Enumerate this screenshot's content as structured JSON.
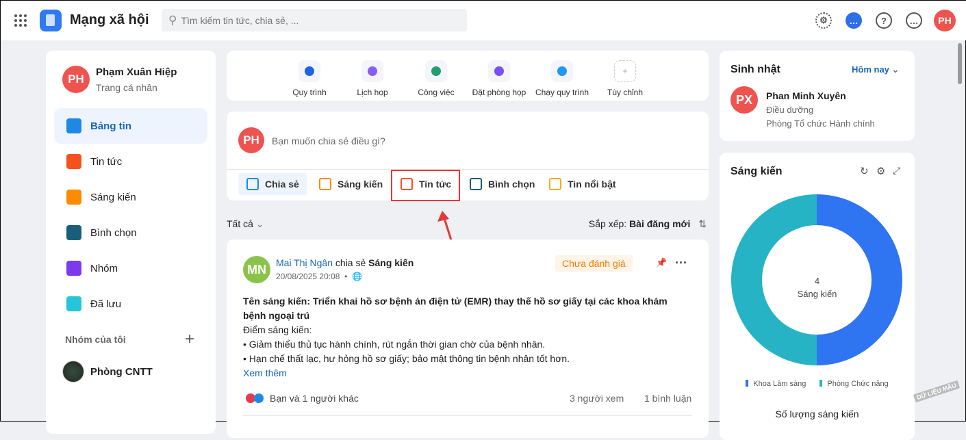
{
  "header": {
    "app_title": "Mạng xã hội",
    "search_placeholder": "Tìm kiếm tin tức, chia sẻ, ...",
    "user_initials": "PH"
  },
  "sidebar": {
    "user_name": "Phạm Xuân Hiệp",
    "user_sub": "Trang cá nhân",
    "user_initials": "PH",
    "items": [
      {
        "label": "Bảng tin",
        "color": "#1e88e5"
      },
      {
        "label": "Tin tức",
        "color": "#f4511e"
      },
      {
        "label": "Sáng kiến",
        "color": "#fb8c00"
      },
      {
        "label": "Bình chọn",
        "color": "#1a5f7a"
      },
      {
        "label": "Nhóm",
        "color": "#7c3aed"
      },
      {
        "label": "Đã lưu",
        "color": "#26c6da"
      }
    ],
    "groups_title": "Nhóm của tôi",
    "groups": [
      {
        "label": "Phòng CNTT"
      }
    ]
  },
  "quick_actions": [
    {
      "label": "Quy trình",
      "color": "#1e63e9"
    },
    {
      "label": "Lịch họp",
      "color": "#8b5cf6"
    },
    {
      "label": "Công việc",
      "color": "#22a06b"
    },
    {
      "label": "Đặt phòng họp",
      "color": "#7c4dff"
    },
    {
      "label": "Chạy quy trình",
      "color": "#2196f3"
    },
    {
      "label": "Tùy chỉnh",
      "color": "#bbbbbb"
    }
  ],
  "composer": {
    "placeholder": "Bạn muốn chia sẻ điều gì?",
    "initials": "PH",
    "tools": [
      {
        "label": "Chia sẻ",
        "color": "#1e88e5"
      },
      {
        "label": "Sáng kiến",
        "color": "#fb8c00"
      },
      {
        "label": "Tin tức",
        "color": "#f4511e"
      },
      {
        "label": "Bình chọn",
        "color": "#1a5f7a"
      },
      {
        "label": "Tin nổi bật",
        "color": "#f9a825"
      }
    ]
  },
  "filter": {
    "label": "Tất cả",
    "sort_label": "Sắp xếp:",
    "sort_value": "Bài đăng mới"
  },
  "post": {
    "initials": "MN",
    "author": "Mai Thị Ngân",
    "action": "chia sẻ",
    "type": "Sáng kiến",
    "time": "20/08/2025 20:08",
    "status": "Chưa đánh giá",
    "title": "Tên sáng kiến: Triển khai hồ sơ bệnh án điện tử (EMR) thay thế hồ sơ giấy tại các khoa khám bệnh ngoại trú",
    "lines": [
      "Điểm sáng kiến:",
      "• Giảm thiểu thủ tục hành chính, rút ngắn thời gian chờ của bệnh nhân.",
      "• Hạn chế thất lạc, hư hỏng hồ sơ giấy; bảo mật thông tin bệnh nhân tốt hơn."
    ],
    "see_more": "Xem thêm",
    "reactions": "Bạn và 1 người khác",
    "views": "3 người xem",
    "comments": "1 bình luận"
  },
  "birthday": {
    "title": "Sinh nhật",
    "filter": "Hôm nay",
    "initials": "PX",
    "name": "Phan Minh Xuyên",
    "role": "Điều dưỡng",
    "dept": "Phòng Tổ chức Hành chính"
  },
  "chart_data": {
    "type": "pie",
    "title": "Sáng kiến",
    "subtitle": "Số lượng sáng kiến",
    "center_value": "4",
    "center_label": "Sáng kiến",
    "legend_position": "bottom",
    "categories": [
      "Khoa Lâm sàng",
      "Phòng Chức năng"
    ],
    "values": [
      2,
      2
    ],
    "colors": [
      "#2f74f0",
      "#26b3c6"
    ]
  },
  "watermark": "DỮ LIỆU MẪU"
}
